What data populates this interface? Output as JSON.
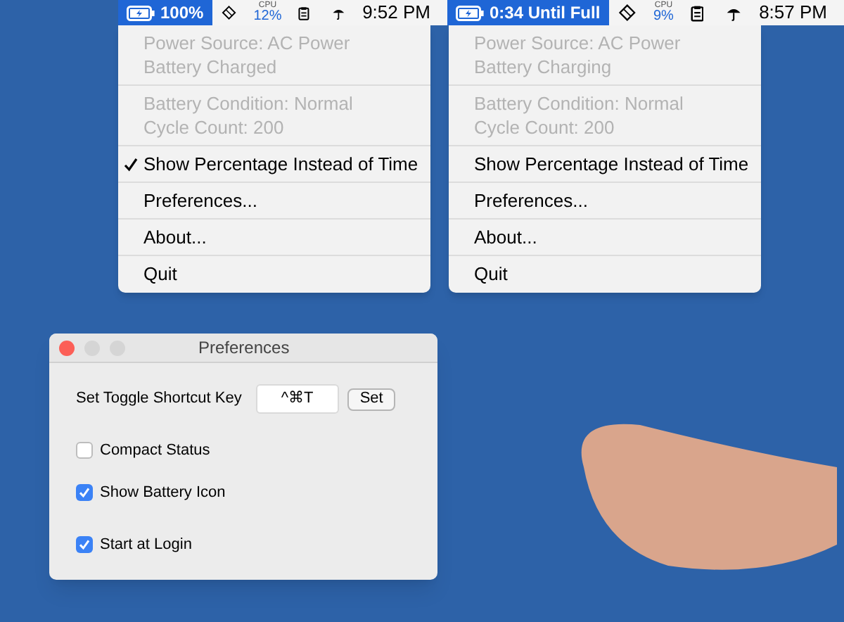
{
  "menubars": [
    {
      "battery": {
        "label": "100%",
        "selected": true
      },
      "cpu": {
        "label": "CPU",
        "value": "12%"
      },
      "time": "9:52 PM",
      "menu": [
        {
          "kind": "info",
          "lines": [
            "Power Source: AC Power",
            "Battery Charged"
          ],
          "disabled": true
        },
        {
          "kind": "info",
          "lines": [
            "Battery Condition: Normal",
            "Cycle Count: 200"
          ],
          "disabled": true
        },
        {
          "kind": "action",
          "lines": [
            "Show Percentage Instead of Time"
          ],
          "disabled": false,
          "checked": true
        },
        {
          "kind": "action",
          "lines": [
            "Preferences..."
          ],
          "disabled": false,
          "checked": false
        },
        {
          "kind": "action",
          "lines": [
            "About..."
          ],
          "disabled": false,
          "checked": false
        },
        {
          "kind": "action",
          "lines": [
            "Quit"
          ],
          "disabled": false,
          "checked": false
        }
      ]
    },
    {
      "battery": {
        "label": "0:34 Until Full",
        "selected": true
      },
      "cpu": {
        "label": "CPU",
        "value": "9%"
      },
      "time": "8:57 PM",
      "menu": [
        {
          "kind": "info",
          "lines": [
            "Power Source: AC Power",
            "Battery Charging"
          ],
          "disabled": true
        },
        {
          "kind": "info",
          "lines": [
            "Battery Condition: Normal",
            "Cycle Count: 200"
          ],
          "disabled": true
        },
        {
          "kind": "action",
          "lines": [
            "Show Percentage Instead of Time"
          ],
          "disabled": false,
          "checked": false
        },
        {
          "kind": "action",
          "lines": [
            "Preferences..."
          ],
          "disabled": false,
          "checked": false
        },
        {
          "kind": "action",
          "lines": [
            "About..."
          ],
          "disabled": false,
          "checked": false
        },
        {
          "kind": "action",
          "lines": [
            "Quit"
          ],
          "disabled": false,
          "checked": false
        }
      ]
    }
  ],
  "preferences": {
    "title": "Preferences",
    "shortcut_label": "Set Toggle Shortcut Key",
    "shortcut_value": "^⌘T",
    "set_button": "Set",
    "options": [
      {
        "label": "Compact Status",
        "checked": false
      },
      {
        "label": "Show Battery Icon",
        "checked": true
      },
      {
        "label": "Start at Login",
        "checked": true
      }
    ]
  }
}
